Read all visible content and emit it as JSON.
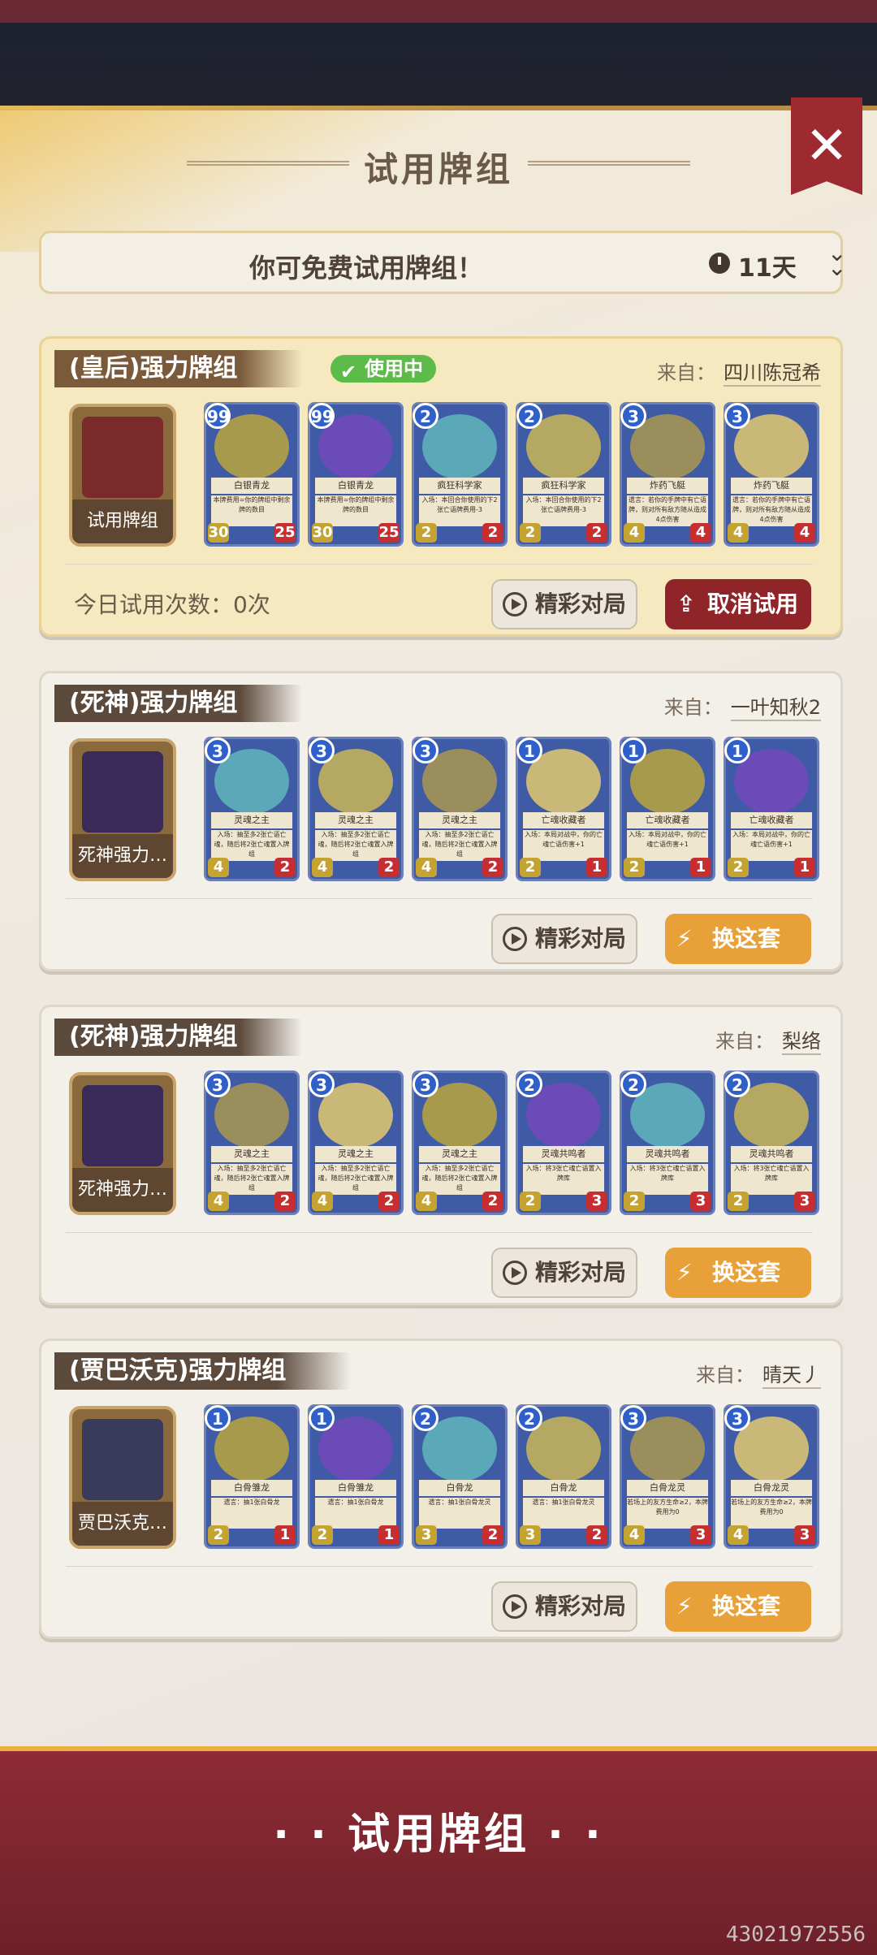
{
  "header": {
    "title": "试用牌组",
    "close_label": "✕"
  },
  "notice": {
    "text": "你可免费试用牌组！",
    "days": "11天"
  },
  "status_badge": "使用中",
  "from_label": "来自：",
  "tries": {
    "label": "今日试用次数：",
    "value": "0次"
  },
  "buttons": {
    "replay": "精彩对局",
    "cancel": "取消试用",
    "swap": "换这套"
  },
  "decks": [
    {
      "title": "(皇后)强力牌组",
      "from": "四川陈冠希",
      "avatar_label": "试用牌组",
      "active": true,
      "cards": [
        {
          "cost": "99",
          "name": "白银青龙",
          "text": "本牌费用=你的牌组中剩余牌的数目",
          "atk": "30",
          "hp": "25"
        },
        {
          "cost": "99",
          "name": "白银青龙",
          "text": "本牌费用=你的牌组中剩余牌的数目",
          "atk": "30",
          "hp": "25"
        },
        {
          "cost": "2",
          "name": "疯狂科学家",
          "text": "入场：本回合你使用的下2张亡语牌费用-3",
          "atk": "2",
          "hp": "2"
        },
        {
          "cost": "2",
          "name": "疯狂科学家",
          "text": "入场：本回合你使用的下2张亡语牌费用-3",
          "atk": "2",
          "hp": "2"
        },
        {
          "cost": "3",
          "name": "炸药飞艇",
          "text": "遗言：若你的手牌中有亡语牌，则对所有敌方随从造成4点伤害",
          "atk": "4",
          "hp": "4"
        },
        {
          "cost": "3",
          "name": "炸药飞艇",
          "text": "遗言：若你的手牌中有亡语牌，则对所有敌方随从造成4点伤害",
          "atk": "4",
          "hp": "4"
        }
      ]
    },
    {
      "title": "(死神)强力牌组",
      "from": "一叶知秋2",
      "avatar_label": "死神强力…",
      "active": false,
      "cards": [
        {
          "cost": "3",
          "name": "灵魂之主",
          "text": "入场：抽至多2张亡语亡魂，随后将2张亡魂置入牌组",
          "atk": "4",
          "hp": "2"
        },
        {
          "cost": "3",
          "name": "灵魂之主",
          "text": "入场：抽至多2张亡语亡魂，随后将2张亡魂置入牌组",
          "atk": "4",
          "hp": "2"
        },
        {
          "cost": "3",
          "name": "灵魂之主",
          "text": "入场：抽至多2张亡语亡魂，随后将2张亡魂置入牌组",
          "atk": "4",
          "hp": "2"
        },
        {
          "cost": "1",
          "name": "亡魂收藏者",
          "text": "入场：本局对战中，你的亡魂亡语伤害+1",
          "atk": "2",
          "hp": "1"
        },
        {
          "cost": "1",
          "name": "亡魂收藏者",
          "text": "入场：本局对战中，你的亡魂亡语伤害+1",
          "atk": "2",
          "hp": "1"
        },
        {
          "cost": "1",
          "name": "亡魂收藏者",
          "text": "入场：本局对战中，你的亡魂亡语伤害+1",
          "atk": "2",
          "hp": "1"
        }
      ]
    },
    {
      "title": "(死神)强力牌组",
      "from": "梨络",
      "avatar_label": "死神强力…",
      "active": false,
      "cards": [
        {
          "cost": "3",
          "name": "灵魂之主",
          "text": "入场：抽至多2张亡语亡魂，随后将2张亡魂置入牌组",
          "atk": "4",
          "hp": "2"
        },
        {
          "cost": "3",
          "name": "灵魂之主",
          "text": "入场：抽至多2张亡语亡魂，随后将2张亡魂置入牌组",
          "atk": "4",
          "hp": "2"
        },
        {
          "cost": "3",
          "name": "灵魂之主",
          "text": "入场：抽至多2张亡语亡魂，随后将2张亡魂置入牌组",
          "atk": "4",
          "hp": "2"
        },
        {
          "cost": "2",
          "name": "灵魂共鸣者",
          "text": "入场：将3张亡魂亡语置入牌库",
          "atk": "2",
          "hp": "3"
        },
        {
          "cost": "2",
          "name": "灵魂共鸣者",
          "text": "入场：将3张亡魂亡语置入牌库",
          "atk": "2",
          "hp": "3"
        },
        {
          "cost": "2",
          "name": "灵魂共鸣者",
          "text": "入场：将3张亡魂亡语置入牌库",
          "atk": "2",
          "hp": "3"
        }
      ]
    },
    {
      "title": "(贾巴沃克)强力牌组",
      "from": "晴天丿",
      "avatar_label": "贾巴沃克…",
      "active": false,
      "cards": [
        {
          "cost": "1",
          "name": "白骨雏龙",
          "text": "遗言：抽1张白骨龙",
          "atk": "2",
          "hp": "1"
        },
        {
          "cost": "1",
          "name": "白骨雏龙",
          "text": "遗言：抽1张白骨龙",
          "atk": "2",
          "hp": "1"
        },
        {
          "cost": "2",
          "name": "白骨龙",
          "text": "遗言：抽1张白骨龙灵",
          "atk": "3",
          "hp": "2"
        },
        {
          "cost": "2",
          "name": "白骨龙",
          "text": "遗言：抽1张白骨龙灵",
          "atk": "3",
          "hp": "2"
        },
        {
          "cost": "3",
          "name": "白骨龙灵",
          "text": "若场上的友方生命≥2，本牌费用为0",
          "atk": "4",
          "hp": "3"
        },
        {
          "cost": "3",
          "name": "白骨龙灵",
          "text": "若场上的友方生命≥2，本牌费用为0",
          "atk": "4",
          "hp": "3"
        }
      ]
    }
  ],
  "footer": {
    "title": "· · 试用牌组 · ·"
  },
  "watermark": "43021972556",
  "colors": {
    "accent_gold": "#e8a039",
    "cancel_red": "#8f2429",
    "in_use_green": "#5dbb4a"
  }
}
